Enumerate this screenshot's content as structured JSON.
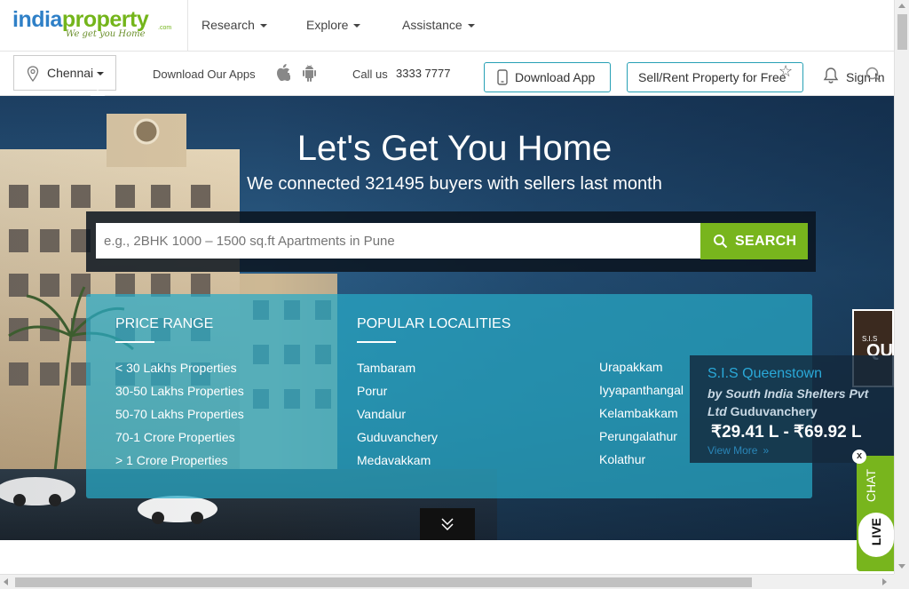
{
  "logo": {
    "part1": "india",
    "part2": "property",
    "suffix": ".com",
    "tagline": "We get you Home"
  },
  "nav": {
    "items": [
      {
        "label": "Research"
      },
      {
        "label": "Explore"
      },
      {
        "label": "Assistance"
      }
    ]
  },
  "subbar": {
    "city": "Chennai",
    "download_apps_text": "Download Our Apps",
    "call_label": "Call us",
    "phone": "3333 7777",
    "download_app_button": "Download App",
    "sell_rent_button": "Sell/Rent Property for Free",
    "sign_in": "Sign In"
  },
  "hero": {
    "title": "Let's Get You Home",
    "subtitle": "We connected 321495 buyers with sellers last month",
    "search_placeholder": "e.g., 2BHK 1000 – 1500 sq.ft Apartments in Pune",
    "search_button": "SEARCH"
  },
  "panel": {
    "price_heading": "PRICE RANGE",
    "price_items": [
      "< 30 Lakhs Properties",
      "30-50 Lakhs Properties",
      "50-70 Lakhs Properties",
      "70-1 Crore Properties",
      "> 1 Crore Properties"
    ],
    "localities_heading": "POPULAR LOCALITIES",
    "localities_col1": [
      "Tambaram",
      "Porur",
      "Vandalur",
      "Guduvanchery",
      "Medavakkam"
    ],
    "localities_col2": [
      "Urapakkam",
      "Iyyapanthangal",
      "Kelambakkam",
      "Perungalathur",
      "Kolathur"
    ]
  },
  "ad": {
    "thumb_text_1": "S.I.S",
    "thumb_text_2": "QU",
    "project": "S.I.S Queenstown",
    "by_text": "by South India Shelters Pvt Ltd",
    "location": "Guduvanchery",
    "price": "₹29.41 L - ₹69.92 L",
    "view_more": "View More"
  },
  "livechat": {
    "close": "x",
    "chat": "CHAT",
    "live": "LIVE"
  },
  "colors": {
    "brand_blue": "#2f80c7",
    "brand_green": "#74b51b",
    "accent_teal": "#27a0b5",
    "search_green": "#78b51d"
  }
}
